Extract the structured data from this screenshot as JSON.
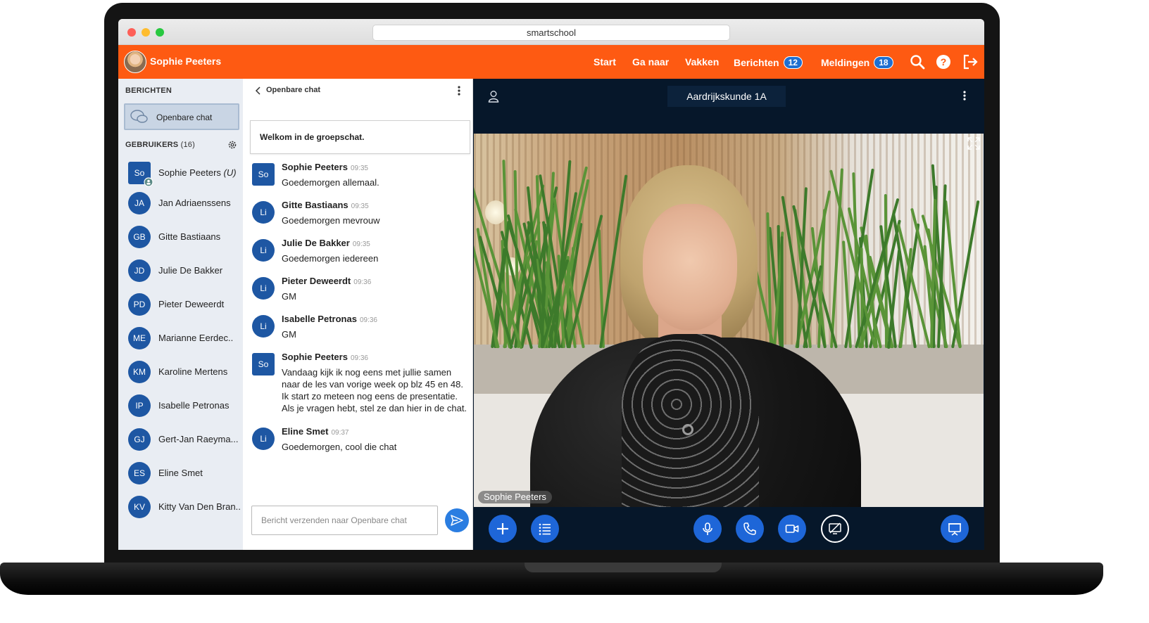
{
  "browser": {
    "url_title": "smartschool"
  },
  "topnav": {
    "user_name": "Sophie Peeters",
    "items": {
      "start": "Start",
      "ga_naar": "Ga naar",
      "vakken": "Vakken",
      "berichten": "Berichten",
      "berichten_count": "12",
      "meldingen": "Meldingen",
      "meldingen_count": "18"
    },
    "icons": [
      "search-icon",
      "help-icon",
      "logout-icon"
    ],
    "brand_color": "#fe5a12",
    "badge_color": "#1f6fd1"
  },
  "sidebar": {
    "berichten_title": "BERICHTEN",
    "open_chat_label": "Openbare chat",
    "gebruikers_title": "GEBRUIKERS",
    "gebruikers_count": "(16)",
    "users": [
      {
        "initials": "So",
        "name": "Sophie Peeters",
        "suffix": "(U)"
      },
      {
        "initials": "JA",
        "name": "Jan Adriaenssens"
      },
      {
        "initials": "GB",
        "name": "Gitte Bastiaans"
      },
      {
        "initials": "JD",
        "name": "Julie De Bakker"
      },
      {
        "initials": "PD",
        "name": "Pieter Deweerdt"
      },
      {
        "initials": "ME",
        "name": "Marianne Eerdec.."
      },
      {
        "initials": "KM",
        "name": "Karoline Mertens"
      },
      {
        "initials": "IP",
        "name": "Isabelle Petronas"
      },
      {
        "initials": "GJ",
        "name": "Gert-Jan Raeyma..."
      },
      {
        "initials": "ES",
        "name": "Eline Smet"
      },
      {
        "initials": "KV",
        "name": "Kitty Van Den Bran.."
      }
    ]
  },
  "chat": {
    "title": "Openbare chat",
    "welcome": "Welkom in de groepschat.",
    "messages": [
      {
        "initials": "So",
        "name": "Sophie Peeters",
        "time": "09:35",
        "text": "Goedemorgen allemaal."
      },
      {
        "initials": "Li",
        "name": "Gitte Bastiaans",
        "time": "09:35",
        "text": "Goedemorgen mevrouw"
      },
      {
        "initials": "Li",
        "name": "Julie De Bakker",
        "time": "09:35",
        "text": "Goedemorgen iedereen"
      },
      {
        "initials": "Li",
        "name": "Pieter Deweerdt",
        "time": "09:36",
        "text": "GM"
      },
      {
        "initials": "Li",
        "name": "Isabelle Petronas",
        "time": "09:36",
        "text": "GM"
      },
      {
        "initials": "So",
        "name": "Sophie Peeters",
        "time": "09:36",
        "text": "Vandaag kijk ik nog eens met jullie samen naar de les van vorige week op blz 45 en 48. Ik start zo meteen nog eens de presentatie. Als je vragen hebt, stel ze dan hier in de chat."
      },
      {
        "initials": "Li",
        "name": "Eline Smet",
        "time": "09:37",
        "text": "Goedemorgen, cool die chat"
      }
    ],
    "input_placeholder": "Bericht verzenden naar Openbare chat"
  },
  "video": {
    "room_name": "Aardrijkskunde 1A",
    "participant_label": "Sophie Peeters",
    "controls": [
      "plus-icon",
      "list-icon",
      "microphone-icon",
      "phone-icon",
      "camera-icon",
      "screen-share-icon",
      "presentation-icon"
    ],
    "control_color": "#1e66d8"
  }
}
